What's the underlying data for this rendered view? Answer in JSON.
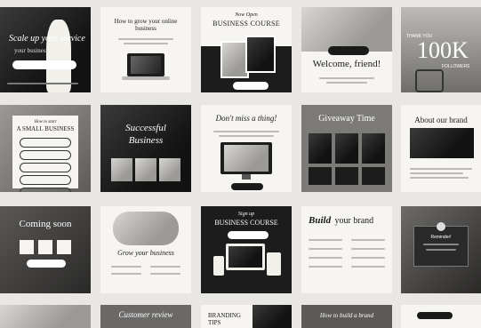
{
  "row1": {
    "t1": {
      "title": "Scale up your service",
      "sub": "your business"
    },
    "t2": {
      "title": "How to grow your online business"
    },
    "t3": {
      "title_top": "Now Open",
      "title_main": "BUSINESS COURSE"
    },
    "t4": {
      "title": "Welcome, friend!"
    },
    "t5": {
      "prefix": "THANK YOU",
      "big": "100K",
      "suffix": "FOLLOWERS"
    }
  },
  "row2": {
    "t1": {
      "title_small": "How to start",
      "title": "A SMALL BUSINESS"
    },
    "t2": {
      "title_a": "Successful",
      "title_b": "Business"
    },
    "t3": {
      "title": "Don't miss a thing!"
    },
    "t4": {
      "title": "Giveaway Time"
    },
    "t5": {
      "title": "About our brand"
    }
  },
  "row3": {
    "t1": {
      "title": "Coming soon"
    },
    "t2": {
      "title": "Grow your business"
    },
    "t3": {
      "title_small": "Sign up",
      "title": "BUSINESS COURSE"
    },
    "t4": {
      "title_a": "Build",
      "title_b": "your brand"
    },
    "t5": {
      "label": "Reminder!"
    }
  },
  "row4": {
    "t2": {
      "title": "Customer review"
    },
    "t3": {
      "title_a": "BRANDING",
      "title_b": "TIPS"
    },
    "t4": {
      "title": "How to build a brand"
    }
  },
  "colors": {
    "ink": "#1a1a1a",
    "paper": "#f7f5f1",
    "stone": "#8d8b88"
  }
}
